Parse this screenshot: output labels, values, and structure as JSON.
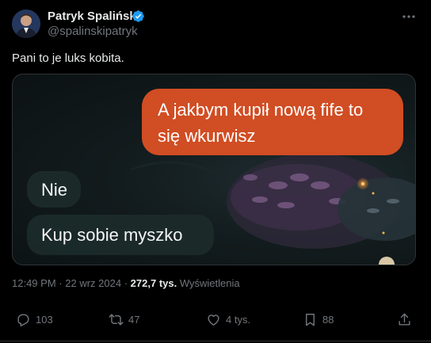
{
  "author": {
    "name": "Patryk Spaliński",
    "handle": "@spalinskipatryk",
    "verified_color": "#1d9bf0"
  },
  "tweet": {
    "text": "Pani to je luks kobita."
  },
  "media": {
    "messages": [
      {
        "side": "outgoing",
        "line1": "A jakbym kupił nową fife to",
        "line2": "się wkurwisz"
      },
      {
        "side": "incoming",
        "text": "Nie"
      },
      {
        "side": "incoming",
        "text": "Kup sobie myszko"
      }
    ],
    "outgoing_color": "#d14d23"
  },
  "meta": {
    "time": "12:49 PM",
    "sep": "·",
    "date": "22 wrz 2024",
    "views_count": "272,7 tys.",
    "views_label": "Wyświetlenia"
  },
  "actions": {
    "replies": "103",
    "retweets": "47",
    "likes": "4 tys.",
    "bookmarks": "88"
  },
  "icons": [
    "avatar",
    "verified-badge-icon",
    "more-icon",
    "reply-icon",
    "retweet-icon",
    "like-icon",
    "bookmark-icon",
    "share-icon"
  ]
}
